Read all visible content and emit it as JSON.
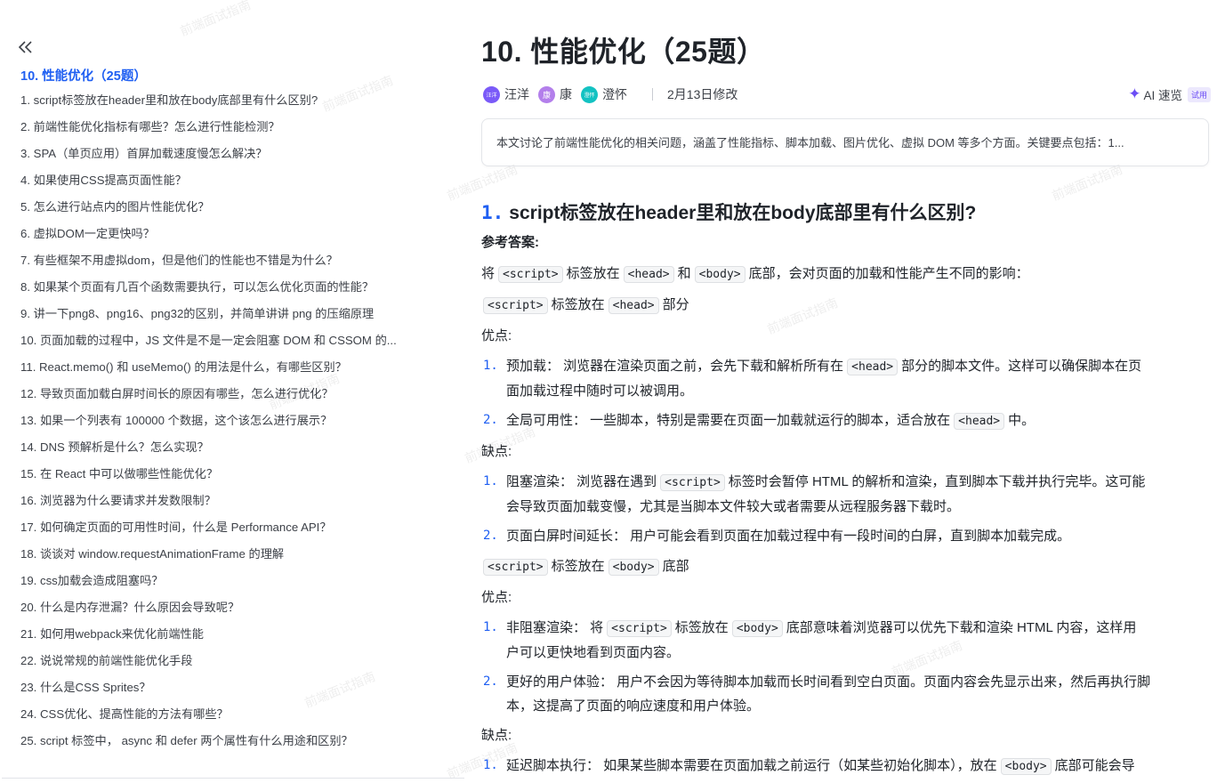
{
  "toc": {
    "title": "10. 性能优化（25题）",
    "items": [
      "1. script标签放在header里和放在body底部里有什么区别?",
      "2. 前端性能优化指标有哪些？怎么进行性能检测？",
      "3. SPA（单页应用）首屏加载速度慢怎么解决？",
      "4. 如果使用CSS提高页面性能？",
      "5. 怎么进行站点内的图片性能优化？",
      "6. 虚拟DOM一定更快吗？",
      "7. 有些框架不用虚拟dom，但是他们的性能也不错是为什么？",
      "8. 如果某个页面有几百个函数需要执行，可以怎么优化页面的性能？",
      "9. 讲一下png8、png16、png32的区别，并简单讲讲 png 的压缩原理",
      "10. 页面加载的过程中，JS 文件是不是一定会阻塞 DOM 和 CSSOM 的...",
      "11. React.memo() 和 useMemo() 的用法是什么，有哪些区别？",
      "12. 导致页面加载白屏时间长的原因有哪些，怎么进行优化？",
      "13. 如果一个列表有 100000 个数据，这个该怎么进行展示？",
      "14. DNS 预解析是什么？怎么实现？",
      "15. 在 React 中可以做哪些性能优化？",
      "16. 浏览器为什么要请求并发数限制？",
      "17. 如何确定页面的可用性时间，什么是 Performance API？",
      "18. 谈谈对 window.requestAnimationFrame 的理解",
      "19. css加载会造成阻塞吗？",
      "20. 什么是内存泄漏？什么原因会导致呢？",
      "21. 如何用webpack来优化前端性能",
      "22. 说说常规的前端性能优化手段",
      "23. 什么是CSS Sprites？",
      "24. CSS优化、提高性能的方法有哪些？",
      "25. script 标签中， async 和 defer 两个属性有什么用途和区别？"
    ]
  },
  "doc": {
    "title": "10. 性能优化（25题）",
    "authors": [
      {
        "name": "汪洋",
        "avatar_text": "汪洋",
        "color": "#7a5af8"
      },
      {
        "name": "康",
        "avatar_text": "康",
        "color": "#b37feb"
      },
      {
        "name": "澄怀",
        "avatar_text": "澄怀",
        "color": "#13c2c2"
      }
    ],
    "modified": "2月13日修改",
    "ai_label": "AI 速览",
    "ai_badge": "试用",
    "summary": "本文讨论了前端性能优化的相关问题，涵盖了性能指标、脚本加载、图片优化、虚拟 DOM 等多个方面。关键要点包括：1...",
    "section": {
      "num": "1.",
      "title": "script标签放在header里和放在body底部里有什么区别?"
    },
    "answer_label": "参考答案:",
    "intro": {
      "a": "将",
      "c1": "<script>",
      "b": "标签放在",
      "c2": "<head>",
      "d": "和",
      "c3": "<body>",
      "e": "底部，会对页面的加载和性能产生不同的影响："
    },
    "head_heading": {
      "c1": "<script>",
      "a": "标签放在",
      "c2": "<head>",
      "b": "部分"
    },
    "pros1": "优点:",
    "pros1_items": [
      {
        "num": "1.",
        "a": "预加载： 浏览器在渲染页面之前，会先下载和解析所有在",
        "code": "<head>",
        "b": "部分的脚本文件。这样可以确保脚本在页",
        "line2": "面加载过程中随时可以被调用。"
      },
      {
        "num": "2.",
        "a": "全局可用性： 一些脚本，特别是需要在页面一加载就运行的脚本，适合放在",
        "code": "<head>",
        "b": "中。"
      }
    ],
    "cons1": "缺点:",
    "cons1_items": [
      {
        "num": "1.",
        "a": "阻塞渲染： 浏览器在遇到",
        "code": "<script>",
        "b": "标签时会暂停 HTML 的解析和渲染，直到脚本下载并执行完毕。这可能",
        "line2": "会导致页面加载变慢，尤其是当脚本文件较大或者需要从远程服务器下载时。"
      },
      {
        "num": "2.",
        "a": "页面白屏时间延长： 用户可能会看到页面在加载过程中有一段时间的白屏，直到脚本加载完成。"
      }
    ],
    "body_heading": {
      "c1": "<script>",
      "a": "标签放在",
      "c2": "<body>",
      "b": "底部"
    },
    "pros2": "优点:",
    "pros2_items": [
      {
        "num": "1.",
        "a": "非阻塞渲染： 将",
        "code": "<script>",
        "b": "标签放在",
        "code2": "<body>",
        "c": "底部意味着浏览器可以优先下载和渲染 HTML 内容，这样用",
        "line2": "户可以更快地看到页面内容。"
      },
      {
        "num": "2.",
        "a": "更好的用户体验： 用户不会因为等待脚本加载而长时间看到空白页面。页面内容会先显示出来，然后再执行脚",
        "line2": "本，这提高了页面的响应速度和用户体验。"
      }
    ],
    "cons2": "缺点:",
    "cons2_items": [
      {
        "num": "1.",
        "a": "延迟脚本执行： 如果某些脚本需要在页面加载之前运行（如某些初始化脚本），放在",
        "code": "<body>",
        "b": "底部可能会导"
      }
    ]
  },
  "watermark": "前端面试指南",
  "colors": {
    "accent": "#1f5ff2",
    "ai": "#6b4df5"
  },
  "icons": {
    "collapse": "double-chevron-left-icon",
    "ai": "sparkle-icon"
  }
}
